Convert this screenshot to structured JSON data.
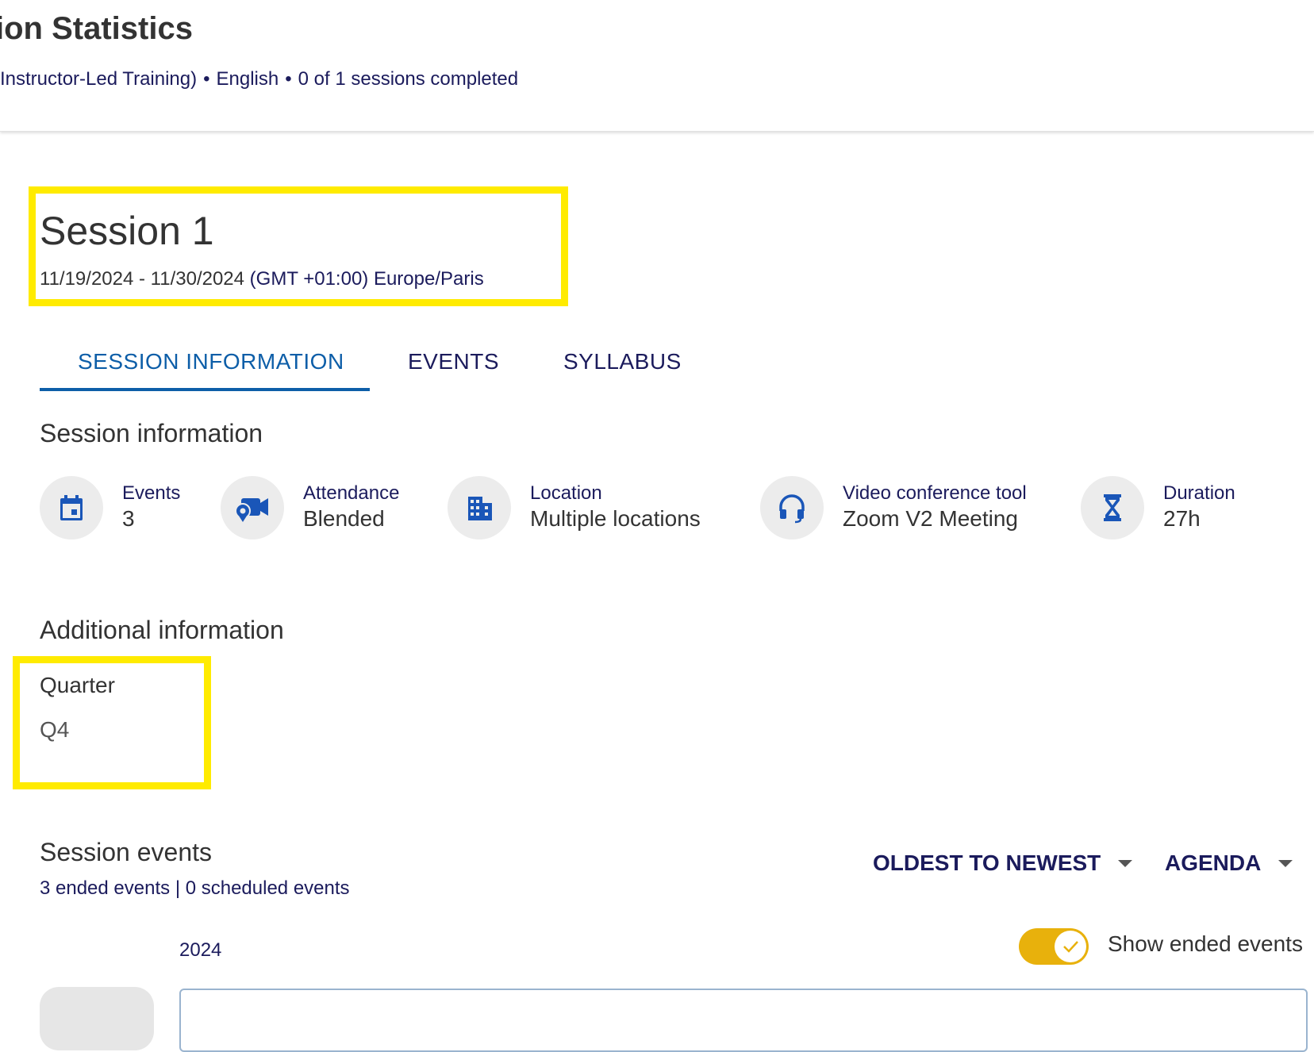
{
  "header": {
    "title": "ion Statistics",
    "subtitle_parts": [
      "Instructor-Led Training)",
      "English",
      "0 of 1 sessions completed"
    ],
    "separator": "•"
  },
  "session": {
    "title": "Session 1",
    "date_range": "11/19/2024 - 11/30/2024",
    "timezone": "(GMT +01:00) Europe/Paris"
  },
  "tabs": [
    {
      "label": "SESSION INFORMATION",
      "active": true
    },
    {
      "label": "EVENTS",
      "active": false
    },
    {
      "label": "SYLLABUS",
      "active": false
    }
  ],
  "session_info": {
    "heading": "Session information",
    "items": [
      {
        "icon": "calendar-icon",
        "label": "Events",
        "value": "3"
      },
      {
        "icon": "video-location-icon",
        "label": "Attendance",
        "value": "Blended"
      },
      {
        "icon": "building-icon",
        "label": "Location",
        "value": "Multiple locations"
      },
      {
        "icon": "headset-icon",
        "label": "Video conference tool",
        "value": "Zoom V2 Meeting"
      },
      {
        "icon": "hourglass-icon",
        "label": "Duration",
        "value": "27h"
      }
    ]
  },
  "additional_info": {
    "heading": "Additional information",
    "quarter_label": "Quarter",
    "quarter_value": "Q4"
  },
  "session_events": {
    "heading": "Session events",
    "ended_events": "3 ended events",
    "divider": "|",
    "scheduled_events": "0 scheduled events",
    "sort_label": "OLDEST TO NEWEST",
    "view_label": "AGENDA",
    "year": "2024",
    "show_ended_label": "Show ended events",
    "show_ended_on": true
  },
  "colors": {
    "accent_blue": "#0d5ea8",
    "navy_text": "#1b1b5c",
    "icon_blue": "#1a56b8",
    "toggle_on": "#e8b10c",
    "highlight": "#ffeb00"
  }
}
